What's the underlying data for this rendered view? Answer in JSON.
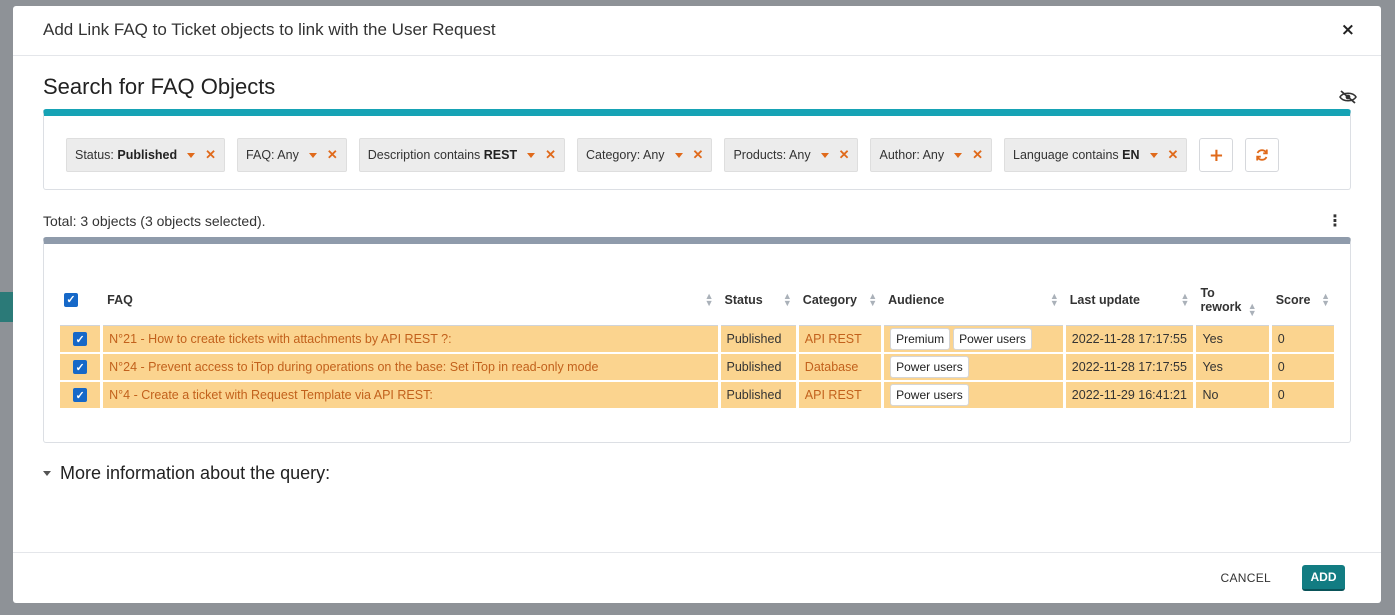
{
  "dialog": {
    "title": "Add Link FAQ to Ticket objects to link with the User Request",
    "close_symbol": "×",
    "section_title": "Search for FAQ Objects"
  },
  "criteria": [
    {
      "label": "Status: ",
      "value": "Published"
    },
    {
      "label": "FAQ: Any",
      "value": ""
    },
    {
      "label": "Description contains ",
      "value": "REST"
    },
    {
      "label": "Category: Any",
      "value": ""
    },
    {
      "label": "Products: Any",
      "value": ""
    },
    {
      "label": "Author: Any",
      "value": ""
    },
    {
      "label": "Language contains ",
      "value": "EN"
    }
  ],
  "criteria_actions": {
    "add_symbol": "+",
    "refresh_symbol": "⟳"
  },
  "results": {
    "total": "Total: 3 objects (3 objects selected).",
    "columns": [
      "FAQ",
      "Status",
      "Category",
      "Audience",
      "Last update",
      "To rework",
      "Score"
    ],
    "rows": [
      {
        "faq": "N°21 - How to create tickets with attachments by API REST ?:",
        "status": "Published",
        "category": "API REST",
        "audience": [
          "Premium",
          "Power users"
        ],
        "last_update": "2022-11-28 17:17:55",
        "to_rework": "Yes",
        "score": "0"
      },
      {
        "faq": "N°24 - Prevent access to iTop during operations on the base: Set iTop in read-only mode",
        "status": "Published",
        "category": "Database",
        "audience": [
          "Power users"
        ],
        "last_update": "2022-11-28 17:17:55",
        "to_rework": "Yes",
        "score": "0"
      },
      {
        "faq": "N°4 - Create a ticket with Request Template via API REST:",
        "status": "Published",
        "category": "API REST",
        "audience": [
          "Power users"
        ],
        "last_update": "2022-11-29 16:41:21",
        "to_rework": "No",
        "score": "0"
      }
    ]
  },
  "more_info": "More information about the query:",
  "footer": {
    "cancel_label": "CANCEL",
    "add_label": "ADD"
  },
  "colors": {
    "accent": "#16a3b5",
    "selected_row": "#fbd48f",
    "primary_button": "#127c82",
    "link": "#c2611c"
  }
}
